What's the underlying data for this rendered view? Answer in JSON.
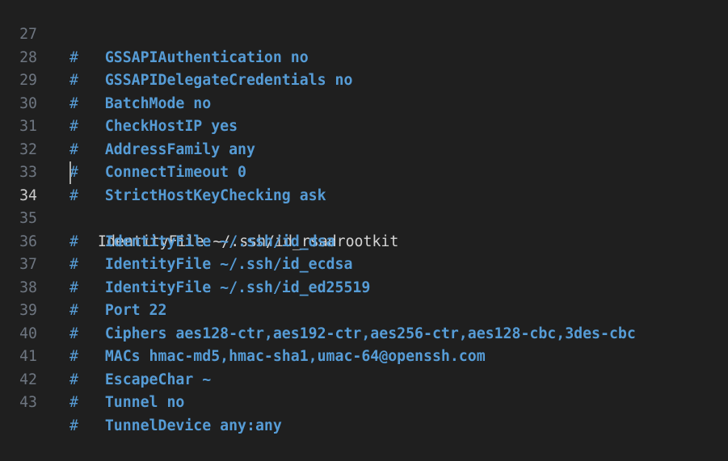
{
  "editor": {
    "colors": {
      "background": "#1f1f1f",
      "line_number": "#6e7681",
      "active_line_number": "#cccccc",
      "comment": "#569cd6",
      "text": "#d4d4d4"
    },
    "active_line": 34,
    "lines": [
      {
        "num": "27",
        "hash": "#",
        "text": "GSSAPIAuthentication no"
      },
      {
        "num": "28",
        "hash": "#",
        "text": "GSSAPIDelegateCredentials no"
      },
      {
        "num": "29",
        "hash": "#",
        "text": "BatchMode no"
      },
      {
        "num": "30",
        "hash": "#",
        "text": "CheckHostIP yes"
      },
      {
        "num": "31",
        "hash": "#",
        "text": "AddressFamily any"
      },
      {
        "num": "32",
        "hash": "#",
        "text": "ConnectTimeout 0"
      },
      {
        "num": "33",
        "hash": "#",
        "text": "StrictHostKeyChecking ask"
      },
      {
        "num": "34",
        "hash": "",
        "text": "IdentityFile ~/.ssh/id_rsadrootkit"
      },
      {
        "num": "35",
        "hash": "#",
        "text": "IdentityFile ~/.ssh/id_dsa"
      },
      {
        "num": "36",
        "hash": "#",
        "text": "IdentityFile ~/.ssh/id_ecdsa"
      },
      {
        "num": "37",
        "hash": "#",
        "text": "IdentityFile ~/.ssh/id_ed25519"
      },
      {
        "num": "38",
        "hash": "#",
        "text": "Port 22"
      },
      {
        "num": "39",
        "hash": "#",
        "text": "Ciphers aes128-ctr,aes192-ctr,aes256-ctr,aes128-cbc,3des-cbc"
      },
      {
        "num": "40",
        "hash": "#",
        "text": "MACs hmac-md5,hmac-sha1,umac-64@openssh.com"
      },
      {
        "num": "41",
        "hash": "#",
        "text": "EscapeChar ~"
      },
      {
        "num": "42",
        "hash": "#",
        "text": "Tunnel no"
      },
      {
        "num": "43",
        "hash": "#",
        "text": "TunnelDevice any:any"
      }
    ]
  }
}
